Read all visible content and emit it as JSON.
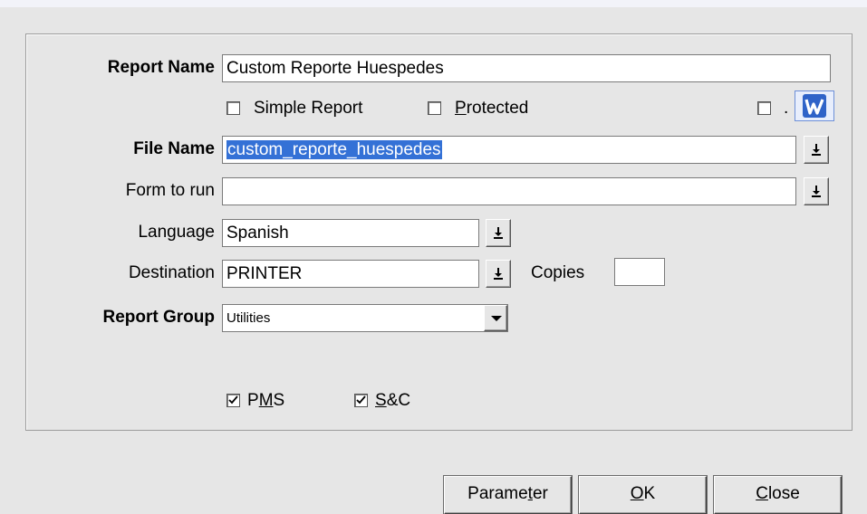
{
  "form": {
    "report_name": {
      "label": "Report Name",
      "value": "Custom Reporte Huespedes"
    },
    "simple_report": {
      "label": "Simple Report",
      "checked": false
    },
    "protected": {
      "label_prefix": "",
      "label_mnemonic": "P",
      "label_rest": "rotected",
      "checked": false
    },
    "extra_checkbox": {
      "checked": false,
      "suffix": "."
    },
    "word_icon": "word-icon",
    "file_name": {
      "label": "File Name",
      "value": "custom_reporte_huespedes"
    },
    "form_to_run": {
      "label": "Form to run",
      "value": ""
    },
    "language": {
      "label": "Language",
      "value": "Spanish"
    },
    "destination": {
      "label": "Destination",
      "value": "PRINTER"
    },
    "copies": {
      "label": "Copies",
      "value": ""
    },
    "report_group": {
      "label": "Report Group",
      "value": "Utilities"
    },
    "pms": {
      "label_prefix": "P",
      "label_mnemonic": "M",
      "label_rest": "S",
      "checked": true
    },
    "sc": {
      "label_prefix": "",
      "label_mnemonic": "S",
      "label_rest": "&C",
      "checked": true
    }
  },
  "buttons": {
    "parameter": {
      "prefix": "Parame",
      "mnemonic": "t",
      "rest": "er"
    },
    "ok": {
      "prefix": "",
      "mnemonic": "O",
      "rest": "K"
    },
    "close": {
      "prefix": "",
      "mnemonic": "C",
      "rest": "lose"
    }
  },
  "colors": {
    "selection": "#3471d6",
    "background": "#e6e6e6"
  }
}
